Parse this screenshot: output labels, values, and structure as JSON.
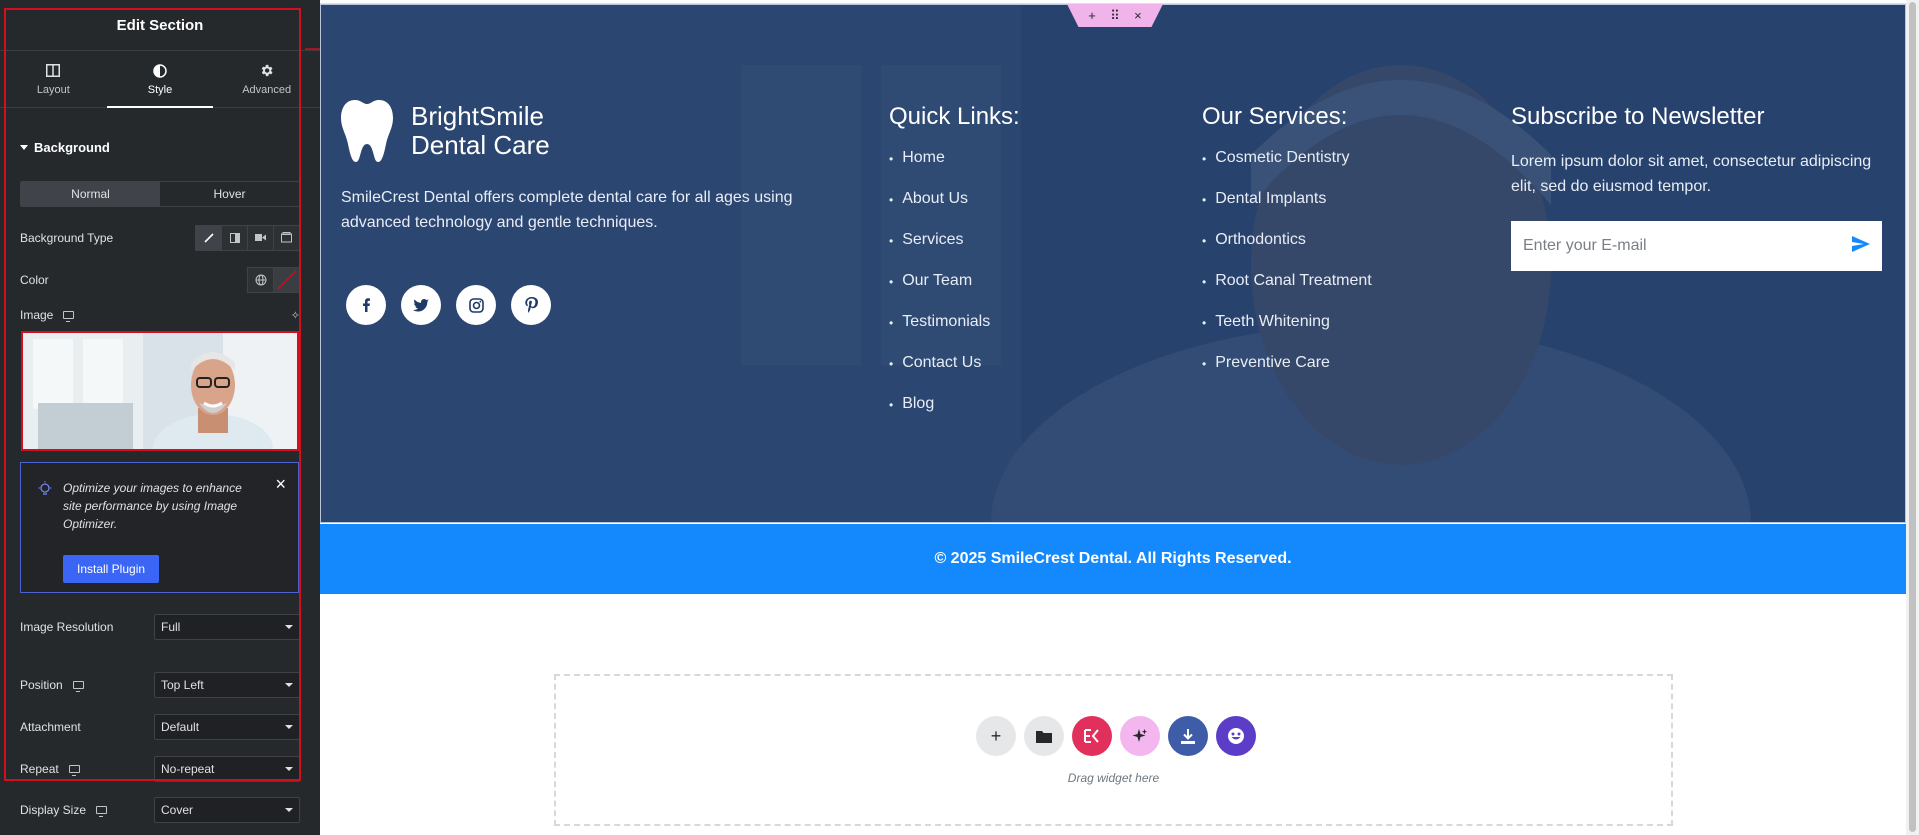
{
  "panel": {
    "title": "Edit Section",
    "tabs": [
      {
        "label": "Layout",
        "icon": "layout-icon"
      },
      {
        "label": "Style",
        "icon": "style-icon"
      },
      {
        "label": "Advanced",
        "icon": "gear-icon"
      }
    ],
    "section_title": "Background",
    "state_tabs": [
      "Normal",
      "Hover"
    ],
    "background_type_label": "Background Type",
    "color_label": "Color",
    "image_label": "Image",
    "notice": {
      "text": "Optimize your images to enhance site performance by using Image Optimizer.",
      "button": "Install Plugin"
    },
    "controls": {
      "image_resolution": {
        "label": "Image Resolution",
        "value": "Full"
      },
      "position": {
        "label": "Position",
        "value": "Top Left"
      },
      "attachment": {
        "label": "Attachment",
        "value": "Default"
      },
      "repeat": {
        "label": "Repeat",
        "value": "No-repeat"
      },
      "display_size": {
        "label": "Display Size",
        "value": "Cover"
      }
    }
  },
  "footer": {
    "brand_line1": "BrightSmile",
    "brand_line2": "Dental Care",
    "description": "SmileCrest Dental offers complete dental care for all ages using advanced technology and gentle techniques.",
    "socials": [
      "facebook-icon",
      "twitter-icon",
      "instagram-icon",
      "pinterest-icon"
    ],
    "quick_links": {
      "title": "Quick Links:",
      "items": [
        "Home",
        "About Us",
        "Services",
        "Our Team",
        "Testimonials",
        "Contact Us",
        "Blog"
      ]
    },
    "services": {
      "title": "Our Services:",
      "items": [
        "Cosmetic Dentistry",
        "Dental Implants",
        "Orthodontics",
        "Root Canal Treatment",
        "Teeth Whitening",
        "Preventive Care"
      ]
    },
    "newsletter": {
      "title": "Subscribe to Newsletter",
      "text": "Lorem ipsum dolor sit amet, consectetur adipiscing elit, sed do eiusmod tempor.",
      "placeholder": "Enter your E-mail"
    },
    "copyright": "© 2025 SmileCrest Dental. All Rights Reserved."
  },
  "dropzone": {
    "label": "Drag widget here"
  },
  "colors": {
    "accent": "#1389fd",
    "footer_bg": "#253d66",
    "panel_bg": "#26292c",
    "toolbar": "#f0b4ea",
    "highlight": "#d10f1f"
  }
}
